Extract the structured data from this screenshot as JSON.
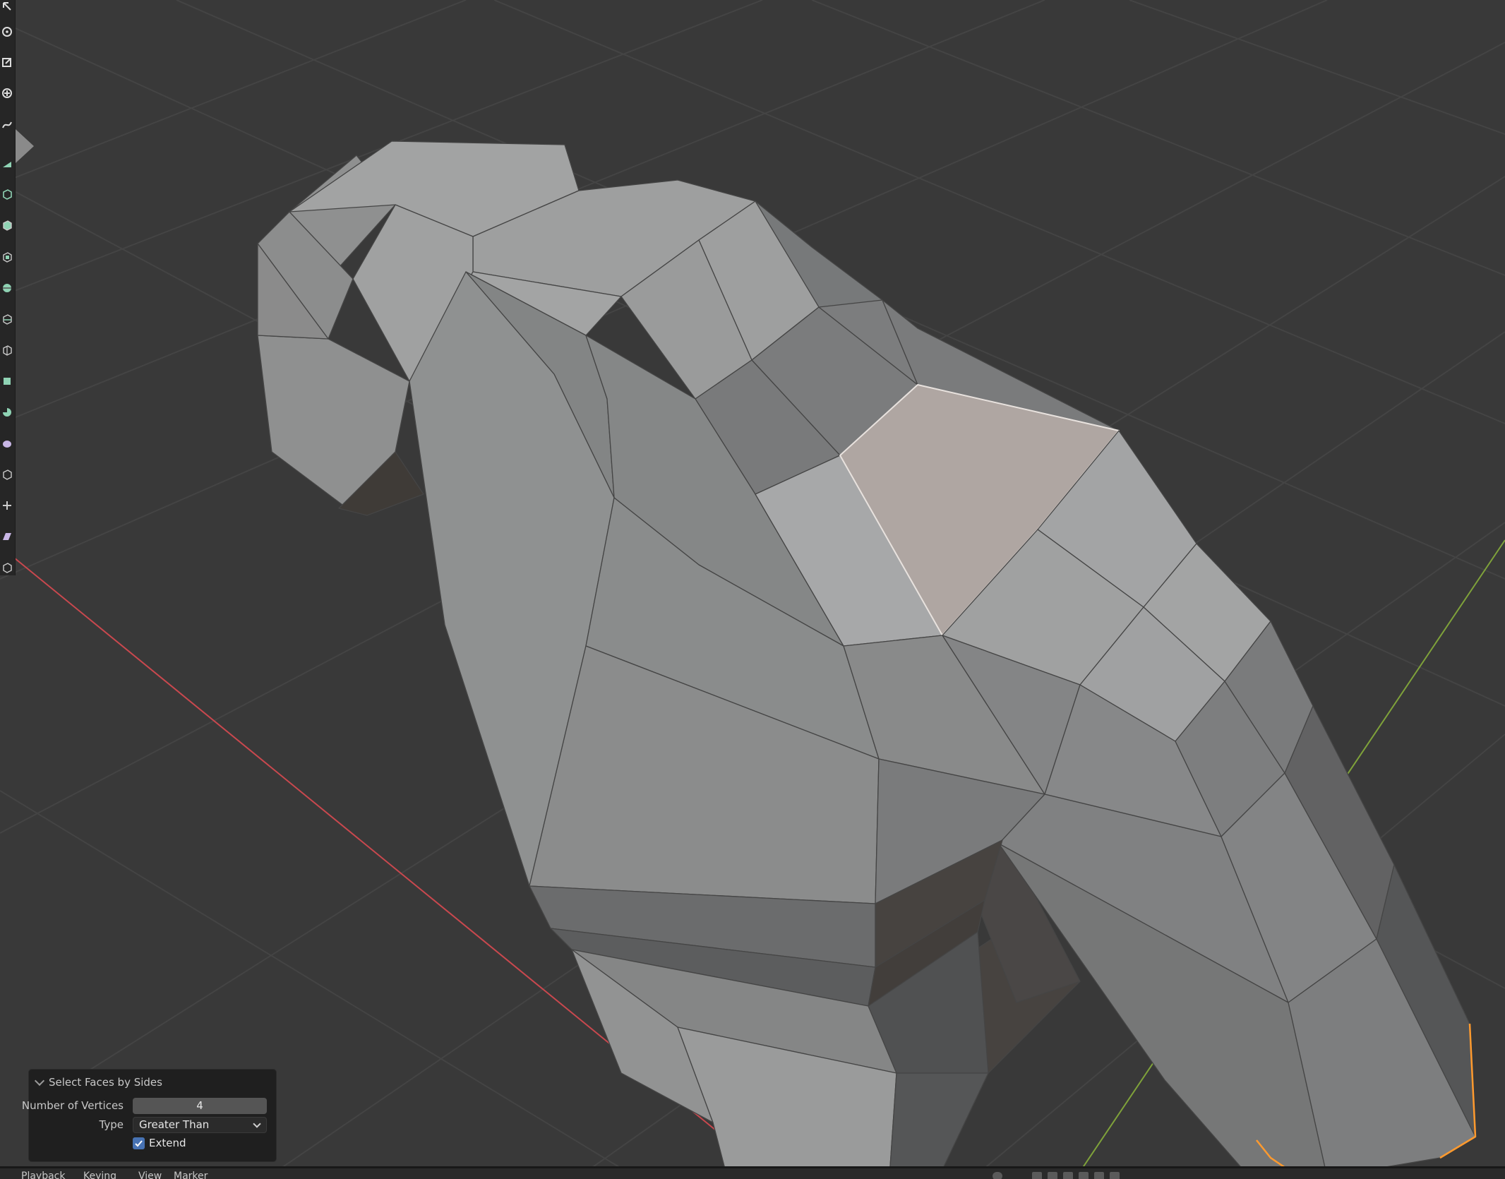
{
  "viewport": {
    "colors": {
      "background": "#393939",
      "grid": "#444444",
      "x_axis": "#c9484e",
      "y_axis": "#7fa23a",
      "selected_face": "#afa6a2",
      "selection_edge": "#ff9a2e"
    }
  },
  "toolbar": {
    "tools": [
      {
        "icon": "cursor-icon"
      },
      {
        "icon": "rotate-icon"
      },
      {
        "icon": "scale-icon"
      },
      {
        "icon": "transform-icon"
      },
      {
        "icon": "annotate-icon"
      },
      {
        "icon": "measure-icon"
      },
      {
        "icon": "add-cube-icon"
      },
      {
        "icon": "extrude-region-icon"
      },
      {
        "icon": "inset-faces-icon"
      },
      {
        "icon": "bevel-icon"
      },
      {
        "icon": "loop-cut-icon"
      },
      {
        "icon": "knife-icon"
      },
      {
        "icon": "poly-build-icon"
      },
      {
        "icon": "spin-icon"
      },
      {
        "icon": "smooth-icon"
      },
      {
        "icon": "edge-slide-icon"
      },
      {
        "icon": "shrink-fatten-icon"
      },
      {
        "icon": "shear-icon"
      },
      {
        "icon": "rip-region-icon"
      }
    ]
  },
  "operator_panel": {
    "title": "Select Faces by Sides",
    "number_of_vertices_label": "Number of Vertices",
    "number_of_vertices_value": "4",
    "type_label": "Type",
    "type_value": "Greater Than",
    "extend_label": "Extend",
    "extend_checked": true
  },
  "timeline": {
    "menus": [
      "Playback",
      "Keying",
      "View",
      "Marker"
    ]
  }
}
